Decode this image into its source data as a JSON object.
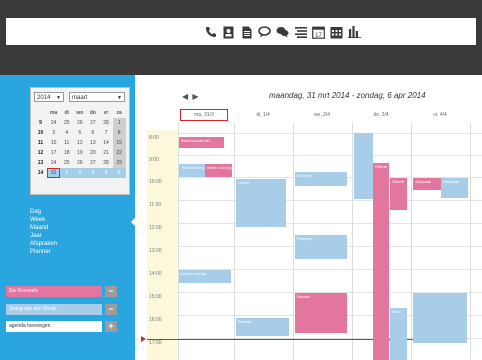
{
  "toolbar": {
    "icons": [
      "phone-icon",
      "contact-card-icon",
      "document-icon",
      "chat-icon",
      "chat-bubbles-icon",
      "list-icon",
      "calendar-17-icon",
      "calendar-grid-icon",
      "bar-chart-icon"
    ],
    "calendar_day_label": "17"
  },
  "mini_calendar": {
    "year": "2014",
    "month": "maart",
    "weekday_headers": [
      "",
      "ma",
      "di",
      "wo",
      "do",
      "vr",
      "za",
      "zo"
    ],
    "weeks": [
      [
        "9",
        "24",
        "25",
        "26",
        "27",
        "28",
        "1",
        "2"
      ],
      [
        "10",
        "3",
        "4",
        "5",
        "6",
        "7",
        "8",
        "9"
      ],
      [
        "11",
        "10",
        "11",
        "12",
        "13",
        "14",
        "15",
        "16"
      ],
      [
        "12",
        "17",
        "18",
        "19",
        "20",
        "21",
        "22",
        "23"
      ],
      [
        "13",
        "24",
        "25",
        "26",
        "27",
        "28",
        "29",
        "30"
      ],
      [
        "14",
        "31",
        "1",
        "2",
        "3",
        "4",
        "5",
        "6"
      ]
    ]
  },
  "views": [
    "Dag",
    "Week",
    "Maand",
    "Jaar",
    "Afspraken",
    "Planner"
  ],
  "agendas": [
    {
      "label": "Els Rosseels",
      "color": "#e2769f"
    },
    {
      "label": "Swing van den Borde",
      "color": "#a7cde9"
    },
    {
      "label": "agenda toevoegen",
      "color": "#ffffff"
    }
  ],
  "calendar": {
    "nav": "◀ ▶",
    "title": "maandag, 31 mrt 2014 - zondag, 6 apr 2014",
    "days": [
      "ma, 31/3",
      "di, 1/4",
      "wo, 2/4",
      "do, 3/4",
      "vr, 4/4"
    ],
    "times": [
      "8:00",
      "9:00",
      "10:00",
      "11:00",
      "12:00",
      "13:00",
      "14:00",
      "15:00",
      "16:00",
      "17:00"
    ],
    "events": [
      {
        "label": "Klant bezoek tel",
        "color": "pink"
      },
      {
        "label": "Teamoverleg",
        "color": "blue"
      },
      {
        "label": "Intern overleg",
        "color": "pink"
      },
      {
        "label": "",
        "color": "blue"
      },
      {
        "label": "Lunch",
        "color": "blue"
      },
      {
        "label": "Bezoek",
        "color": "blue"
      },
      {
        "label": "Lunch overleg",
        "color": "blue"
      },
      {
        "label": "Overleg",
        "color": "blue"
      },
      {
        "label": "Offerte",
        "color": "pink"
      },
      {
        "label": "Offerte",
        "color": "pink"
      },
      {
        "label": "Planning",
        "color": "blue"
      },
      {
        "label": "Bezoek",
        "color": "pink"
      },
      {
        "label": "Klant",
        "color": "blue"
      },
      {
        "label": "Afspraak",
        "color": "pink"
      },
      {
        "label": "Afspraak",
        "color": "blue"
      }
    ]
  }
}
